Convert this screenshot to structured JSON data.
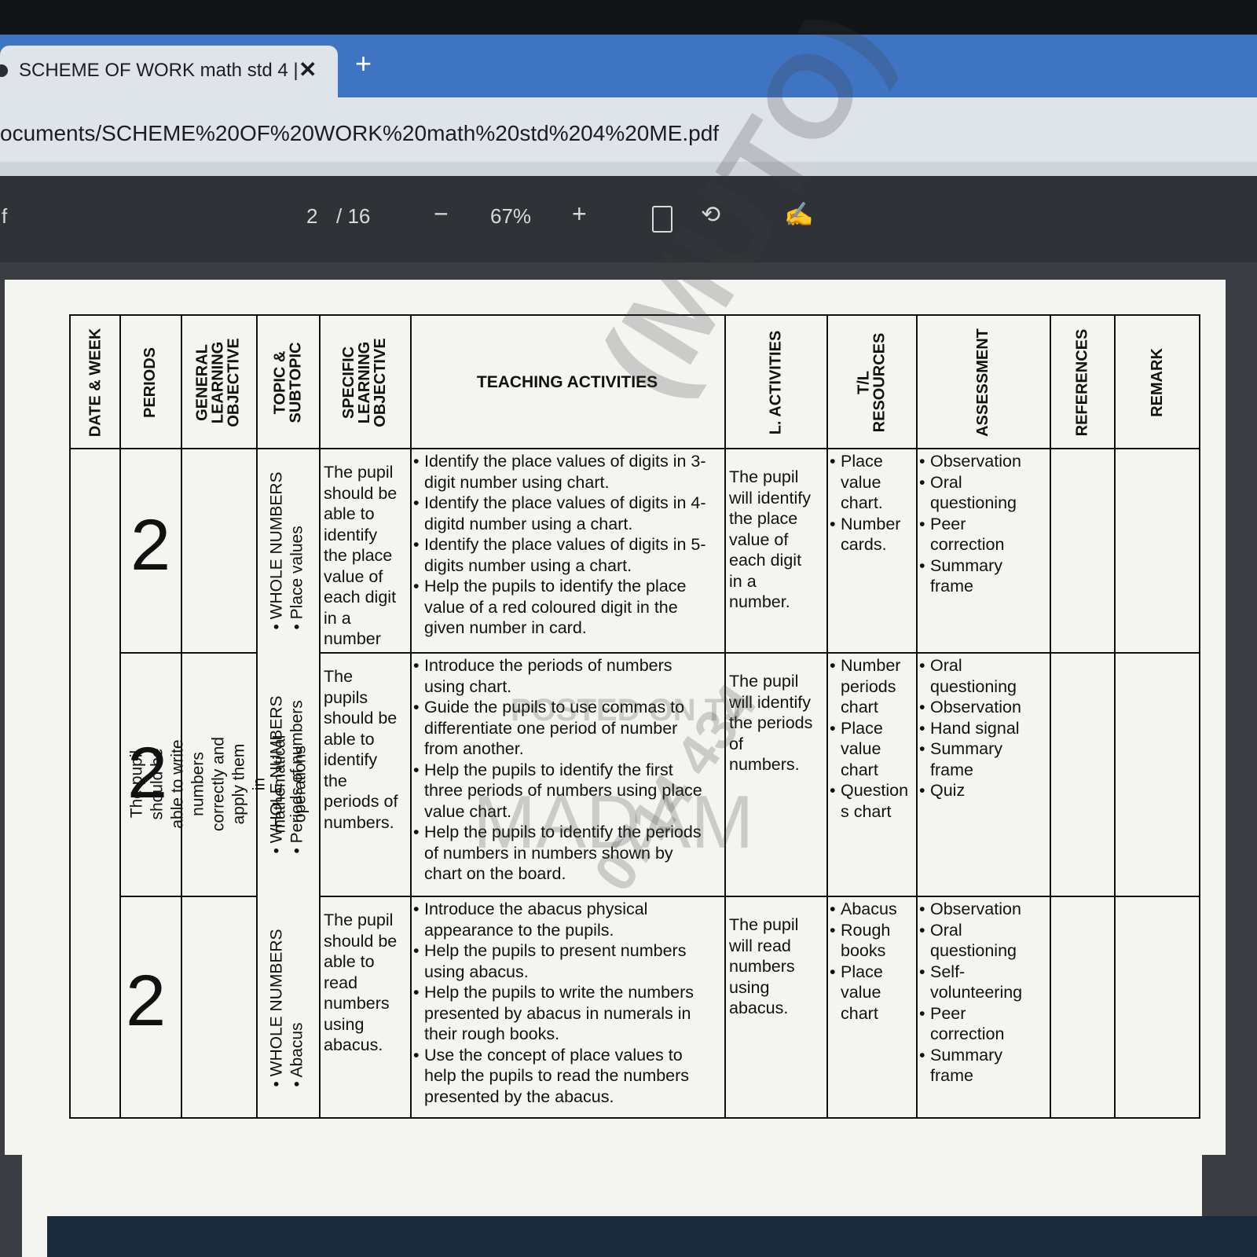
{
  "browser": {
    "tab_title": "SCHEME OF WORK math std 4 |",
    "tab_close": "✕",
    "new_tab": "+",
    "url": "ocuments/SCHEME%20OF%20WORK%20math%20std%204%20ME.pdf"
  },
  "pdf_toolbar": {
    "sidebar_glyph": "f",
    "page_current": "2",
    "page_total": "/ 16",
    "zoom_out": "−",
    "zoom_level": "67%",
    "zoom_in": "+",
    "rotate_glyph": "⟲",
    "draw_glyph": "✍"
  },
  "table": {
    "headers": {
      "date_week": "DATE & WEEK",
      "periods": "PERIODS",
      "general_objective": "GENERAL LEARNING OBJECTIVE",
      "topic": "TOPIC & SUBTOPIC",
      "specific_objective": "SPECIFIC LEARNING OBJECTIVE",
      "teaching_activities": "TEACHING ACTIVITIES",
      "l_activities": "L. ACTIVITIES",
      "resources": "T/L RESOURCES",
      "assessment": "ASSESSMENT",
      "references": "REFERENCES",
      "remark": "REMARK"
    },
    "general_objective_text": "The pupil should be able to write numbers correctly and apply them in mathematical operations",
    "rows": [
      {
        "period": "2",
        "topic": "WHOLE NUMBERS",
        "subtopic": "Place values",
        "specific": [
          "The pupil",
          "should be",
          "able to",
          "identify",
          "the place",
          "value of",
          "each digit",
          "in a",
          "number"
        ],
        "activities": [
          "Identify the place values of digits in 3-|digit number using chart.",
          "Identify the place values of digits in 4-|digitd number using a chart.",
          "Identify the place values of digits in 5-|digits number using a chart.",
          "Help the pupils to identify the place|value of a red coloured digit in the|given number in card."
        ],
        "l_activity": [
          "The pupil",
          "will identify",
          "the place",
          "value of",
          "each digit",
          "in a",
          "number."
        ],
        "resources": [
          "Place|value|chart.",
          "Number|cards."
        ],
        "assessment": [
          "Observation",
          "Oral|questioning",
          "Peer|correction",
          "Summary|frame"
        ]
      },
      {
        "period": "2",
        "topic": "WHOLE NUMBERS",
        "subtopic": "Periods of numbers",
        "specific": [
          "The",
          "pupils",
          "should be",
          "able to",
          "identify",
          "the",
          "periods of",
          "numbers."
        ],
        "activities": [
          "Introduce the periods of numbers|using chart.",
          "Guide the pupils to use commas to|differentiate one period of number|from another.",
          "Help the pupils to identify the first|three periods of numbers using place|value chart.",
          "Help the pupils to identify the periods|of numbers in numbers shown by|chart on the board."
        ],
        "l_activity": [
          "The pupil",
          "will identify",
          "the periods",
          "of",
          "numbers."
        ],
        "resources": [
          "Number|periods|chart",
          "Place|value|chart",
          "Question|s chart"
        ],
        "assessment": [
          "Oral|questioning",
          "Observation",
          "Hand signal",
          "Summary|frame",
          "Quiz"
        ]
      },
      {
        "period": "2",
        "topic": "WHOLE NUMBERS",
        "subtopic": "Abacus",
        "specific": [
          "The pupil",
          "should be",
          "able to",
          "read",
          "numbers",
          "using",
          "abacus."
        ],
        "activities": [
          "Introduce the abacus physical|appearance to the pupils.",
          "Help the pupils to present numbers|using abacus.",
          "Help the pupils to write the numbers|presented by abacus in numerals in|their rough books.",
          "Use the concept of place values to|help the pupils to read the numbers|presented by the abacus."
        ],
        "l_activity": [
          "The pupil",
          "will read",
          "numbers",
          "using",
          "abacus."
        ],
        "resources": [
          "Abacus",
          "Rough|books",
          "Place|value|chart"
        ],
        "assessment": [
          "Observation",
          "Oral|questioning",
          "Self-|volunteering",
          "Peer|correction",
          "Summary|frame"
        ]
      }
    ]
  },
  "watermarks": {
    "stamp": "(MUTO)",
    "number": "0714 434",
    "posted": "POSTED ON TJ",
    "madam": "MADAM"
  }
}
